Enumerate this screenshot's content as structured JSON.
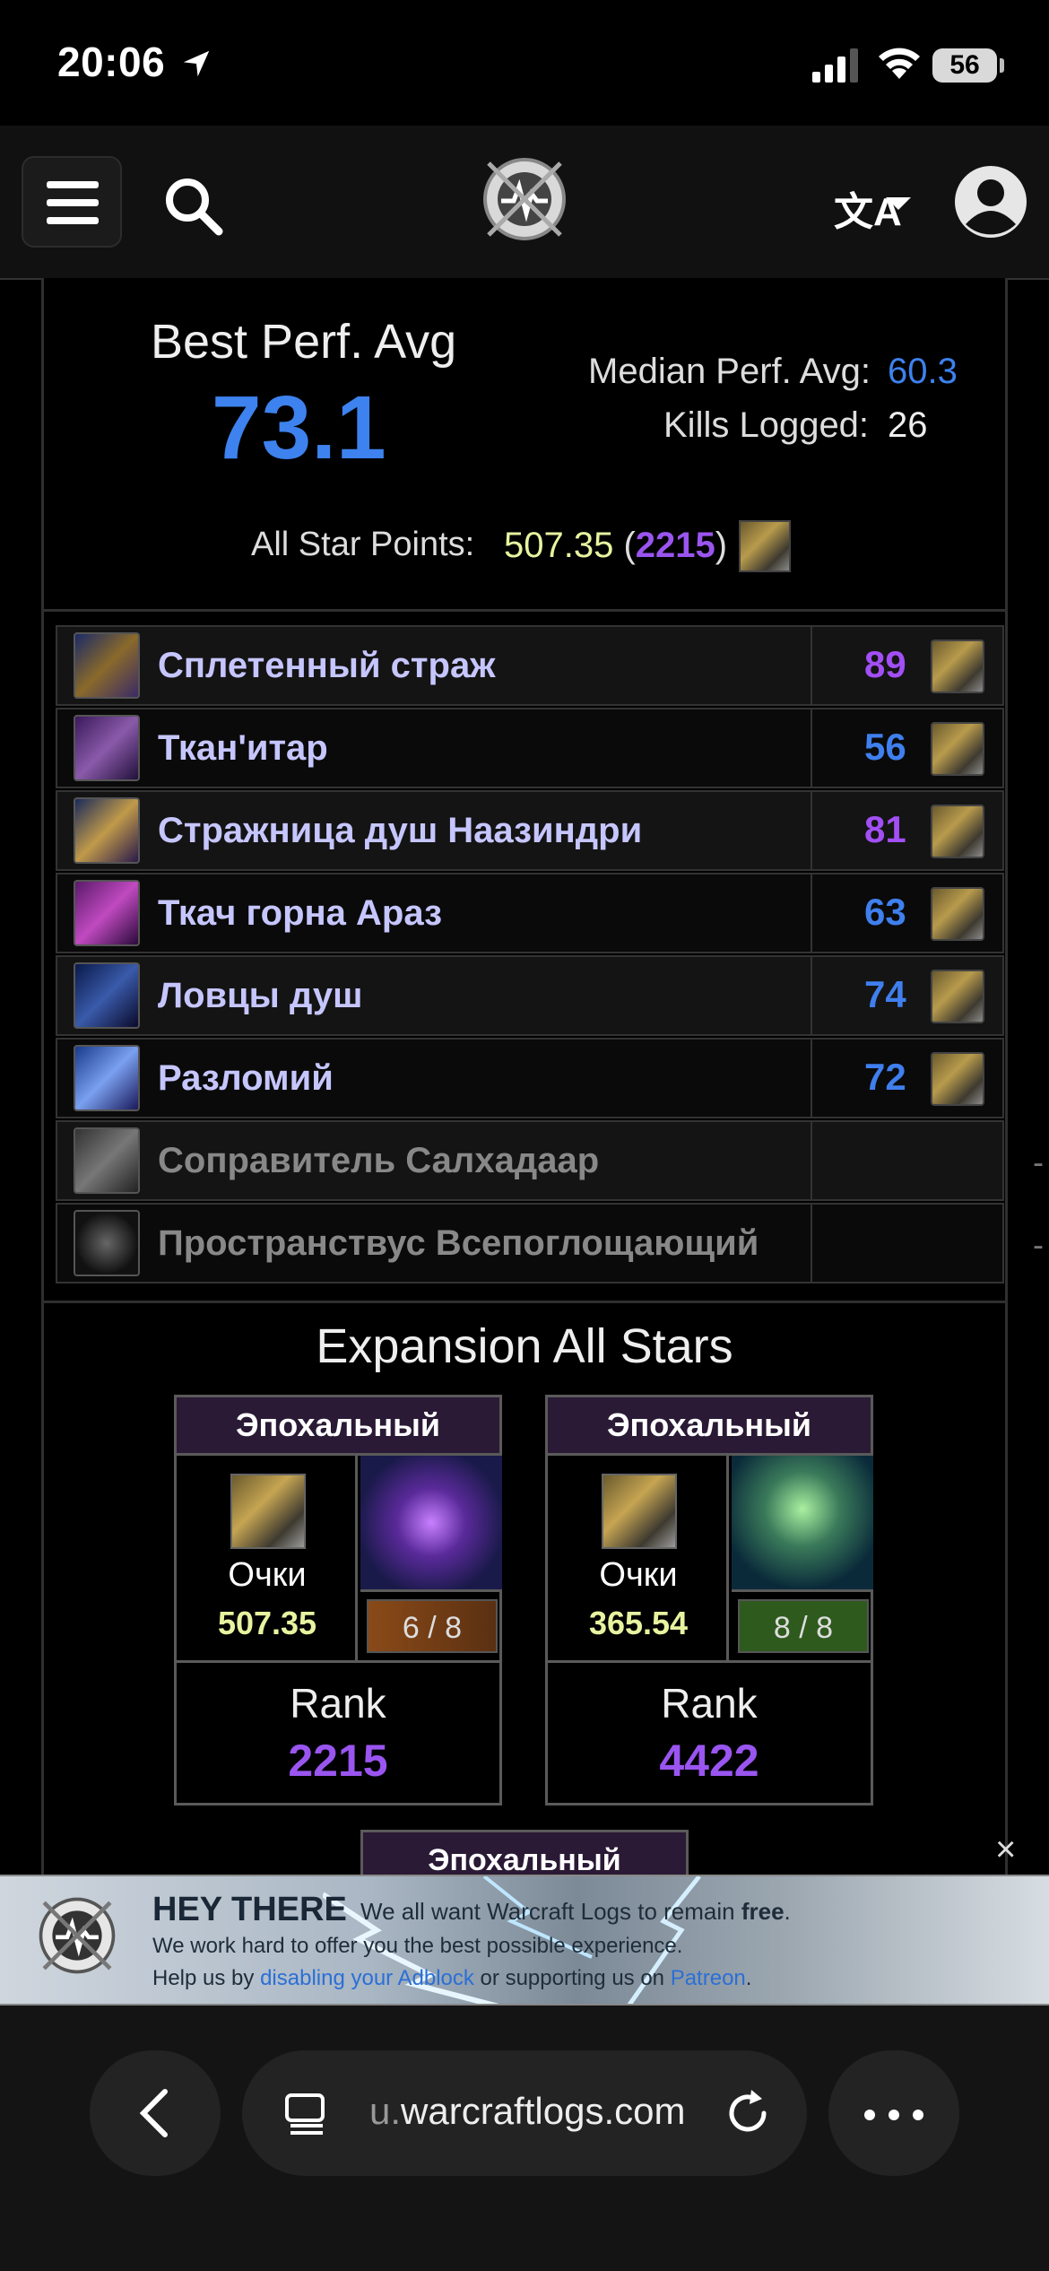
{
  "status_bar": {
    "time": "20:06",
    "battery": "56"
  },
  "summary": {
    "best_label": "Best Perf. Avg",
    "best_value": "73.1",
    "median_label": "Median Perf. Avg:",
    "median_value": "60.3",
    "kills_label": "Kills Logged:",
    "kills_value": "26",
    "stars_label": "All Star Points:",
    "stars_points": "507.35",
    "stars_open": " (",
    "stars_rank": "2215",
    "stars_close": ")"
  },
  "bosses": [
    {
      "name": "Сплетенный страж",
      "score": "89",
      "score_color": "#a24ff5",
      "active": true
    },
    {
      "name": "Ткан'итар",
      "score": "56",
      "score_color": "#3f7fee",
      "active": true
    },
    {
      "name": "Стражница душ Наазиндри",
      "score": "81",
      "score_color": "#a24ff5",
      "active": true
    },
    {
      "name": "Ткач горна Араз",
      "score": "63",
      "score_color": "#3f7fee",
      "active": true
    },
    {
      "name": "Ловцы душ",
      "score": "74",
      "score_color": "#3f7fee",
      "active": true
    },
    {
      "name": "Разломий",
      "score": "72",
      "score_color": "#3f7fee",
      "active": true
    },
    {
      "name": "Соправитель Салхадаар",
      "score": "-",
      "active": false
    },
    {
      "name": "Пространствус Всепоглощающий",
      "score": "-",
      "active": false
    }
  ],
  "expansion": {
    "title": "Expansion All Stars",
    "cards": [
      {
        "difficulty": "Эпохальный",
        "points_label": "Очки",
        "points": "507.35",
        "progress": "6 / 8",
        "progress_color": "#7a4a1e",
        "rank_label": "Rank",
        "rank": "2215"
      },
      {
        "difficulty": "Эпохальный",
        "points_label": "Очки",
        "points": "365.54",
        "progress": "8 / 8",
        "progress_color": "#2e5a1e",
        "rank_label": "Rank",
        "rank": "4422"
      }
    ],
    "third_card_difficulty": "Эпохальный"
  },
  "banner": {
    "title": "HEY THERE",
    "line1_a": "We all want Warcraft Logs to remain ",
    "line1_b": "free",
    "line1_c": ".",
    "line2": "We work hard to offer you the best possible experience.",
    "line3_a": "Help us by ",
    "line3_b": "disabling your Adblock",
    "line3_c": " or supporting us on ",
    "line3_d": "Patreon",
    "line3_e": ".",
    "close": "×"
  },
  "browser": {
    "url_prefix": "u.",
    "url_domain": "warcraftlogs.com"
  }
}
